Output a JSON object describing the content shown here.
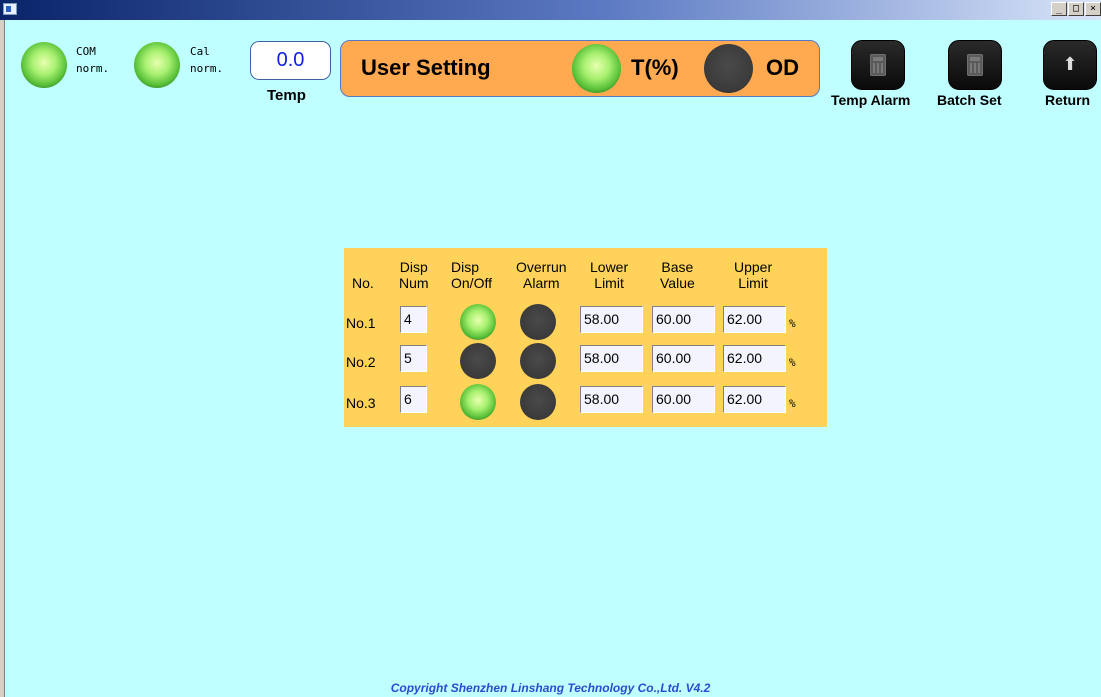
{
  "status": {
    "com": {
      "line1": "COM",
      "line2": "norm.",
      "on": true
    },
    "cal": {
      "line1": "Cal",
      "line2": "norm.",
      "on": true
    },
    "temp_value": "0.0",
    "temp_label": "Temp"
  },
  "banner": {
    "title": "User Setting",
    "mode_t": {
      "label": "T(%)",
      "on": true
    },
    "mode_od": {
      "label": "OD",
      "on": false
    }
  },
  "toolbar": {
    "temp_alarm_label": "Temp Alarm",
    "batch_set_label": "Batch Set",
    "return_label": "Return",
    "temp_alarm_icon": "calculator-icon",
    "batch_set_icon": "calculator-icon",
    "return_icon": "up-arrow-icon"
  },
  "table": {
    "headers": {
      "no": "No.",
      "disp_num": [
        "Disp",
        "Num"
      ],
      "disp_onoff": [
        "Disp",
        "On/Off"
      ],
      "overrun": [
        "Overrun",
        "Alarm"
      ],
      "lower": [
        "Lower",
        "Limit"
      ],
      "base": [
        "Base",
        "Value"
      ],
      "upper": [
        "Upper",
        "Limit"
      ]
    },
    "unit": "%",
    "rows": [
      {
        "no": "No.1",
        "disp_num": "4",
        "disp_on": true,
        "overrun_alarm": false,
        "lower": "58.00",
        "base": "60.00",
        "upper": "62.00"
      },
      {
        "no": "No.2",
        "disp_num": "5",
        "disp_on": false,
        "overrun_alarm": false,
        "lower": "58.00",
        "base": "60.00",
        "upper": "62.00"
      },
      {
        "no": "No.3",
        "disp_num": "6",
        "disp_on": true,
        "overrun_alarm": false,
        "lower": "58.00",
        "base": "60.00",
        "upper": "62.00"
      }
    ]
  },
  "footer": "Copyright Shenzhen Linshang Technology Co.,Ltd. V4.2",
  "colors": {
    "background": "#c0ffff",
    "banner": "#ffa950",
    "panel": "#ffd35a",
    "footer_text": "#2c4cd0",
    "temp_value": "#1020e0",
    "lamp_on": "#58c038",
    "lamp_off": "#3a3a3a"
  }
}
